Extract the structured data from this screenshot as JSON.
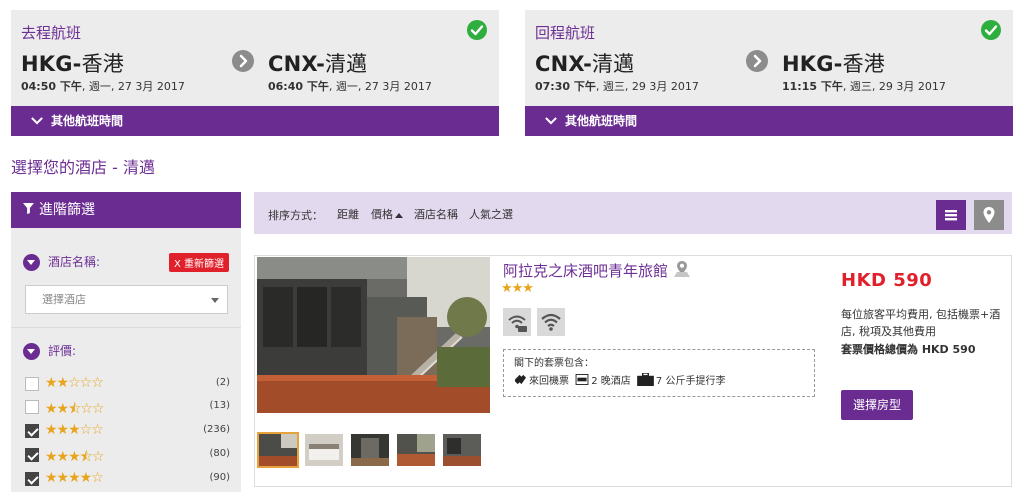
{
  "outbound": {
    "title": "去程航班",
    "from_code": "HKG-",
    "from_city": "香港",
    "from_time": "04:50 下午",
    "from_date": ", 週一, 27 3月 2017",
    "to_code": "CNX-",
    "to_city": "清邁",
    "to_time": "06:40 下午",
    "to_date": ", 週一, 27 3月 2017",
    "other_label": "其他航班時間"
  },
  "return": {
    "title": "回程航班",
    "from_code": "CNX-",
    "from_city": "清邁",
    "from_time": "07:30 下午",
    "from_date": ", 週三, 29 3月 2017",
    "to_code": "HKG-",
    "to_city": "香港",
    "to_time": "11:15 下午",
    "to_date": ", 週三, 29 3月 2017",
    "other_label": "其他航班時間"
  },
  "heading": "選擇您的酒店 - 清邁",
  "filter": {
    "title": "進階篩選",
    "hotel_name_label": "酒店名稱:",
    "reset_label": "X 重新篩選",
    "hotel_placeholder": "選擇酒店",
    "rating_label": "評價:",
    "ratings": [
      {
        "stars": "★★☆☆☆",
        "count": "(2)",
        "checked": false
      },
      {
        "stars": "★★⯪☆☆",
        "count": "(13)",
        "checked": false
      },
      {
        "stars": "★★★☆☆",
        "count": "(236)",
        "checked": true
      },
      {
        "stars": "★★★⯪☆",
        "count": "(80)",
        "checked": true
      },
      {
        "stars": "★★★★☆",
        "count": "(90)",
        "checked": true
      }
    ]
  },
  "sort": {
    "label": "排序方式：",
    "items": [
      "距離",
      "價格",
      "酒店名稱",
      "人氣之選"
    ]
  },
  "hotel": {
    "name": "阿拉克之床酒吧青年旅館",
    "stars": "★★★",
    "package_title": "閣下的套票包含：",
    "package_items": [
      "來回機票",
      "2 晚酒店",
      "7 公斤手提行李"
    ],
    "price": "HKD 590",
    "price_desc": "每位旅客平均費用, 包括機票+酒店, 稅項及其他費用",
    "price_total": "套票價格總價為 HKD 590",
    "select_label": "選擇房型"
  },
  "colors": {
    "brand_purple": "#6a2c91",
    "price_red": "#e0202b",
    "check_green": "#2eae3f",
    "star_gold": "#e8a51b"
  }
}
